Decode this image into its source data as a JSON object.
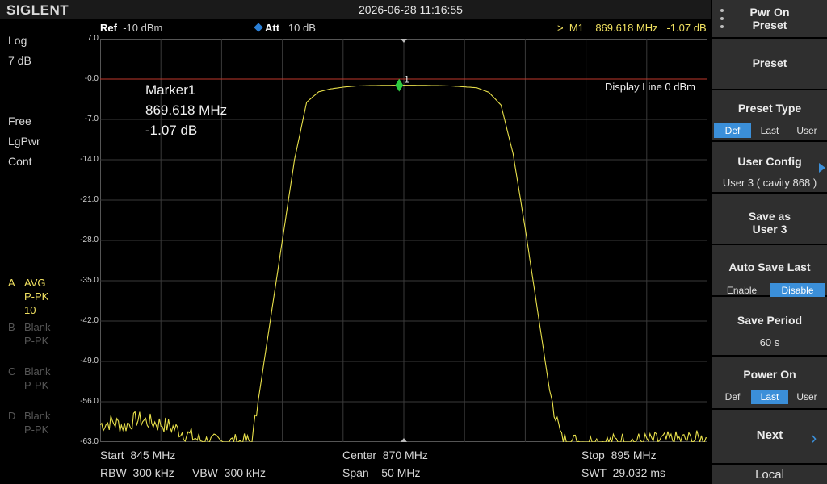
{
  "topbar": {
    "logo": "SIGLENT",
    "datetime": "2026-06-28 11:16:55"
  },
  "left": {
    "scale_type": "Log",
    "scale_div": "7 dB",
    "trigger": "Free",
    "avg_type": "LgPwr",
    "sweep": "Cont",
    "traces": [
      {
        "letter": "A",
        "line1": "AVG",
        "line2": "P-PK",
        "line3": "10"
      },
      {
        "letter": "B",
        "line1": "Blank",
        "line2": "P-PK"
      },
      {
        "letter": "C",
        "line1": "Blank",
        "line2": "P-PK"
      },
      {
        "letter": "D",
        "line1": "Blank",
        "line2": "P-PK"
      }
    ]
  },
  "header": {
    "ref_label": "Ref",
    "ref_value": "-10 dBm",
    "att_label": "Att",
    "att_value": "10 dB",
    "marker_readout": ">  M1    869.618 MHz   -1.07 dB"
  },
  "y_ticks": [
    "7.0",
    "-0.0",
    "-7.0",
    "-14.0",
    "-21.0",
    "-28.0",
    "-35.0",
    "-42.0",
    "-49.0",
    "-56.0",
    "-63.0"
  ],
  "marker": {
    "title": "Marker1",
    "freq": "869.618 MHz",
    "level": "-1.07 dB",
    "number": "1",
    "freq_mhz": 869.618,
    "level_db": -1.07
  },
  "display_line": {
    "label": "Display Line 0 dBm",
    "level_dbm": 0
  },
  "bottom": {
    "start": "Start  845 MHz",
    "center": "Center  870 MHz",
    "stop": "Stop  895 MHz",
    "rbw": "RBW  300 kHz",
    "vbw": "VBW  300 kHz",
    "span": "Span    50 MHz",
    "swt": "SWT  29.032 ms"
  },
  "chart_data": {
    "type": "line",
    "x_range_mhz": [
      845,
      895
    ],
    "y_range_db": [
      -63,
      7
    ],
    "ref_level_dbm": -10,
    "grid": true,
    "series": [
      {
        "color": "#e8e04a",
        "x": [
          845,
          846,
          847,
          848,
          849,
          850,
          851,
          852,
          853,
          854,
          855,
          856,
          857,
          857.5,
          858,
          859,
          860,
          861,
          862,
          863,
          864,
          865,
          866,
          868,
          870,
          872,
          874,
          876,
          877,
          878,
          879,
          880,
          881,
          882,
          883,
          884,
          885,
          886,
          887,
          888,
          890,
          892,
          894,
          895
        ],
        "y": [
          -60,
          -59.5,
          -60.2,
          -59,
          -59.5,
          -59.8,
          -60.5,
          -61.5,
          -62.5,
          -63,
          -63,
          -63,
          -63,
          -63,
          -56,
          -42,
          -28,
          -14,
          -4,
          -2.2,
          -1.7,
          -1.4,
          -1.2,
          -1.1,
          -1.07,
          -1.1,
          -1.2,
          -1.5,
          -2.3,
          -4.5,
          -13,
          -26,
          -40,
          -54,
          -62.5,
          -62.8,
          -63,
          -62.8,
          -63,
          -62.7,
          -62.8,
          -62.6,
          -62.5,
          -62.3
        ]
      }
    ]
  },
  "menu": {
    "items": [
      {
        "title": "Pwr On",
        "title2": "Preset"
      },
      {
        "title": "Preset"
      },
      {
        "title": "Preset Type",
        "options": [
          "Def",
          "Last",
          "User"
        ],
        "selected": 0
      },
      {
        "title": "User Config",
        "sub": "User 3 ( cavity 868 )"
      },
      {
        "title": "Save as",
        "title2": "User 3"
      },
      {
        "title": "Auto Save Last",
        "options": [
          "Enable",
          "Disable"
        ],
        "selected": 1
      },
      {
        "title": "Save Period",
        "sub": "60 s"
      },
      {
        "title": "Power On",
        "options": [
          "Def",
          "Last",
          "User"
        ],
        "selected": 1
      },
      {
        "title": "Next"
      }
    ],
    "local": "Local"
  },
  "colors": {
    "accent": "#3b8fd9",
    "trace": "#e8e04a",
    "marker": "#2ecc40",
    "display_line": "#c0392b"
  }
}
